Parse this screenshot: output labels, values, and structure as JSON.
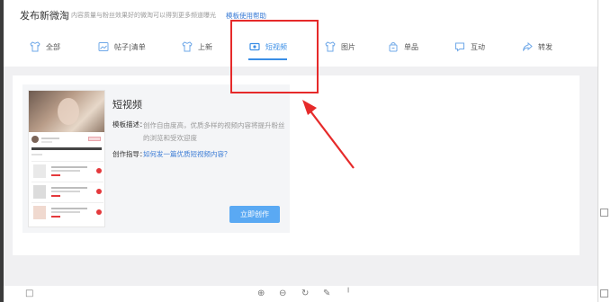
{
  "header": {
    "title": "发布新微淘",
    "subtitle": "内容质量与粉丝效果好的微淘可以得到更多频道曝光",
    "help_link": "模板使用帮助"
  },
  "tabs": [
    {
      "label": "全部",
      "icon": "shirt-icon"
    },
    {
      "label": "帖子|清单",
      "icon": "image-list-icon"
    },
    {
      "label": "上新",
      "icon": "shirt-icon"
    },
    {
      "label": "短视频",
      "icon": "video-icon",
      "active": true
    },
    {
      "label": "图片",
      "icon": "shirt-icon"
    },
    {
      "label": "单品",
      "icon": "bag-icon"
    },
    {
      "label": "互动",
      "icon": "chat-icon"
    },
    {
      "label": "转发",
      "icon": "share-icon"
    }
  ],
  "template": {
    "name": "短视频",
    "desc_label": "模板描述：",
    "desc": "创作自由度高，优质多样的视频内容将提升粉丝的浏览和受欢迎度",
    "guide_label": "创作指导：",
    "guide_link": "如何发一篇优质短视频内容？",
    "create_button": "立即创作"
  },
  "colors": {
    "accent": "#3a8ee6",
    "button": "#5aa9f3",
    "annotation": "#e62a2a"
  }
}
